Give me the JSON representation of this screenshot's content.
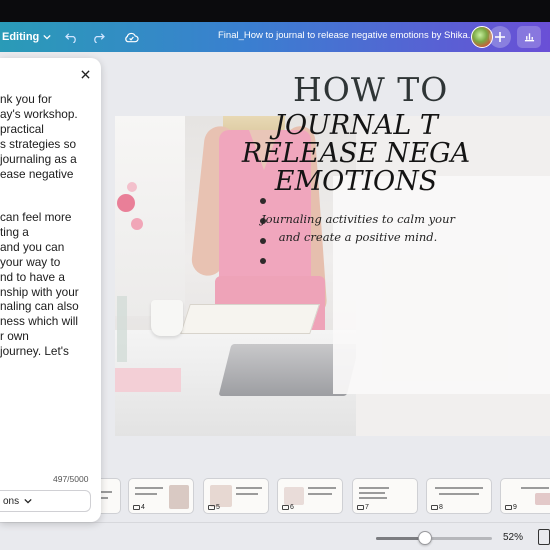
{
  "header": {
    "editing_label": "Editing",
    "doc_title": "Final_How to journal to release negative emotions by Shika..."
  },
  "notes_panel": {
    "lines_p1": [
      "nk you for",
      "ay's workshop.",
      "practical",
      "s strategies so",
      "journaling as a",
      "ease negative"
    ],
    "lines_p2": [
      "can feel more",
      "ting a",
      "and you can",
      "your way to",
      "nd to have a",
      "nship with your",
      "naling can also",
      "ness which will",
      "r own",
      "journey. Let's"
    ],
    "char_count": "497/5000",
    "bottom_button_label": "ons"
  },
  "slide": {
    "heading": "HOW TO",
    "title": "JOURNAL T\nRELEASE NEGA\nEMOTIONS",
    "subtitle": "Journaling activities to calm your\nand create a positive mind."
  },
  "thumbnails": [
    {
      "num": ""
    },
    {
      "num": "4"
    },
    {
      "num": "5"
    },
    {
      "num": "6"
    },
    {
      "num": "7"
    },
    {
      "num": "8"
    },
    {
      "num": "9"
    }
  ],
  "zoom": {
    "label": "52%",
    "value_percent": 52
  },
  "colors": {
    "header_start": "#2a9bb7",
    "header_end": "#6a4fd6",
    "vest_pink": "#f0a6bd"
  }
}
